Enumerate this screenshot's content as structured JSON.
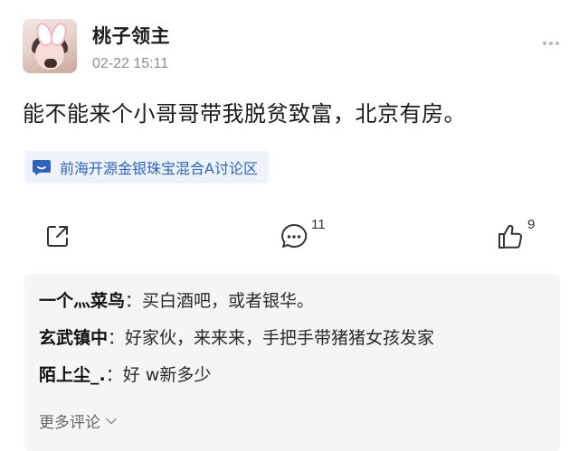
{
  "post": {
    "username": "桃子领主",
    "timestamp": "02-22 15:11",
    "text": "能不能来个小哥哥带我脱贫致富，北京有房。",
    "topic": "前海开源金银珠宝混合A讨论区"
  },
  "actions": {
    "comment_count": "11",
    "like_count": "9"
  },
  "comments": [
    {
      "author": "一个灬菜鸟",
      "separator": "：",
      "text": "买白酒吧，或者银华。"
    },
    {
      "author": "玄武镇中",
      "separator": "：",
      "text": "好家伙，来来来，手把手带猪猪女孩发家"
    },
    {
      "author": "陌上尘_.",
      "separator": "：",
      "text": "好 w新多少"
    }
  ],
  "more_comments_label": "更多评论",
  "icons": {
    "avatar": "user-avatar-bunny-ears",
    "more": "more-dots-icon",
    "topic": "topic-chat-icon",
    "share": "share-icon",
    "comment": "comment-icon",
    "like": "thumbs-up-icon",
    "expand": "chevron-down-icon"
  },
  "colors": {
    "topic_text": "#2f64b8",
    "topic_bg": "#eef3fb",
    "timestamp": "#8d8d8d",
    "comments_bg": "#f5f5f5"
  }
}
